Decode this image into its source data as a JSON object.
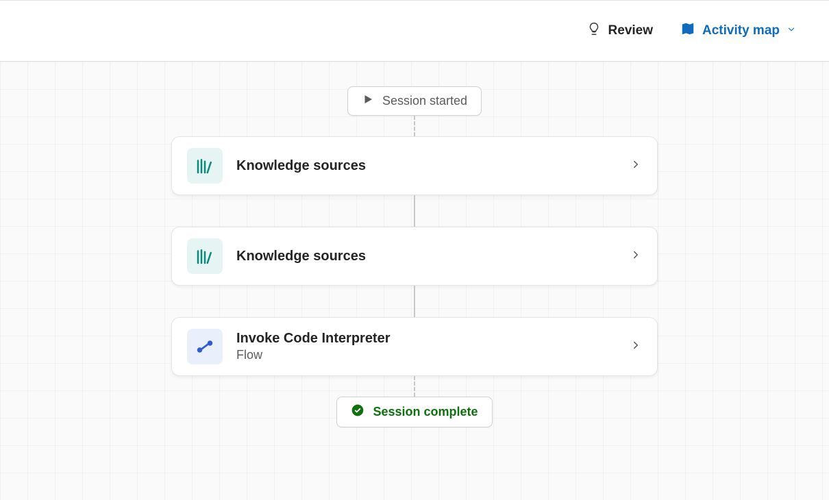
{
  "topbar": {
    "review_label": "Review",
    "activity_map_label": "Activity map"
  },
  "session": {
    "start_label": "Session started",
    "complete_label": "Session complete"
  },
  "nodes": [
    {
      "title": "Knowledge sources",
      "subtitle": "",
      "icon": "knowledge",
      "icon_bg": "teal"
    },
    {
      "title": "Knowledge sources",
      "subtitle": "",
      "icon": "knowledge",
      "icon_bg": "teal"
    },
    {
      "title": "Invoke Code Interpreter",
      "subtitle": "Flow",
      "icon": "flow",
      "icon_bg": "blue"
    }
  ],
  "colors": {
    "accent": "#0f6cbd",
    "success": "#0e700e",
    "teal_icon": "#0a8a7a",
    "flow_icon": "#2f5dd8"
  }
}
